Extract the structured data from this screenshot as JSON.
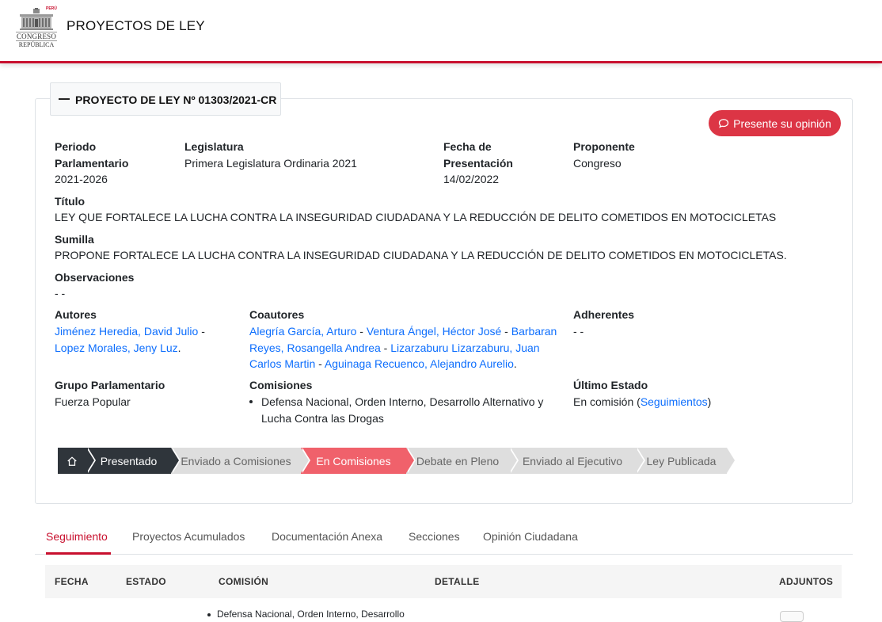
{
  "header": {
    "logo_line1": "CONGRESO",
    "logo_line2": "REPÚBLICA",
    "logo_tag": "PERÚ",
    "title": "PROYECTOS DE LEY"
  },
  "project": {
    "heading": "PROYECTO DE LEY Nº 01303/2021-CR",
    "opinion_button": "Presente su opinión",
    "periodo_label": "Periodo Parlamentario",
    "periodo_value": "2021-2026",
    "legislatura_label": "Legislatura",
    "legislatura_value": "Primera Legislatura Ordinaria 2021",
    "fecha_label": "Fecha de Presentación",
    "fecha_value": "14/02/2022",
    "proponente_label": "Proponente",
    "proponente_value": "Congreso",
    "titulo_label": "Título",
    "titulo_value": "LEY QUE FORTALECE LA LUCHA CONTRA LA INSEGURIDAD CIUDADANA Y LA REDUCCIÓN DE DELITO COMETIDOS EN MOTOCICLETAS",
    "sumilla_label": "Sumilla",
    "sumilla_value": "PROPONE FORTALECE LA LUCHA CONTRA LA INSEGURIDAD CIUDADANA Y LA REDUCCIÓN DE DELITO COMETIDOS EN MOTOCICLETAS.",
    "observaciones_label": "Observaciones",
    "observaciones_value": "- -",
    "autores_label": "Autores",
    "autores": [
      "Jiménez Heredia, David Julio",
      "Lopez Morales, Jeny Luz"
    ],
    "coautores_label": "Coautores",
    "coautores": [
      "Alegría García, Arturo",
      "Ventura Ángel, Héctor José",
      "Barbaran Reyes, Rosangella Andrea",
      "Lizarzaburu Lizarzaburu, Juan Carlos Martin",
      "Aguinaga Recuenco, Alejandro Aurelio"
    ],
    "adherentes_label": "Adherentes",
    "adherentes_value": "- -",
    "grupo_label": "Grupo Parlamentario",
    "grupo_value": "Fuerza Popular",
    "comisiones_label": "Comisiones",
    "comisiones": [
      "Defensa Nacional, Orden Interno, Desarrollo Alternativo y Lucha Contra las Drogas"
    ],
    "estado_label": "Último Estado",
    "estado_prefix": "En comisión (",
    "estado_link": "Seguimientos",
    "estado_suffix": ")"
  },
  "steps": [
    {
      "label": "Presentado",
      "state": "done"
    },
    {
      "label": "Enviado a Comisiones",
      "state": "pending"
    },
    {
      "label": "En Comisiones",
      "state": "current"
    },
    {
      "label": "Debate en Pleno",
      "state": "pending"
    },
    {
      "label": "Enviado al Ejecutivo",
      "state": "pending"
    },
    {
      "label": "Ley Publicada",
      "state": "pending"
    }
  ],
  "tabs": [
    "Seguimiento",
    "Proyectos Acumulados",
    "Documentación Anexa",
    "Secciones",
    "Opinión Ciudadana"
  ],
  "table": {
    "headers": [
      "FECHA",
      "ESTADO",
      "COMISIÓN",
      "DETALLE",
      "ADJUNTOS"
    ],
    "first_row_comision": "Defensa Nacional, Orden Interno, Desarrollo"
  },
  "colors": {
    "brand_red": "#c8102e",
    "button_red": "#dc3545",
    "step_dark": "#2f353b",
    "step_current": "#f0616b",
    "link": "#0d6efd"
  }
}
